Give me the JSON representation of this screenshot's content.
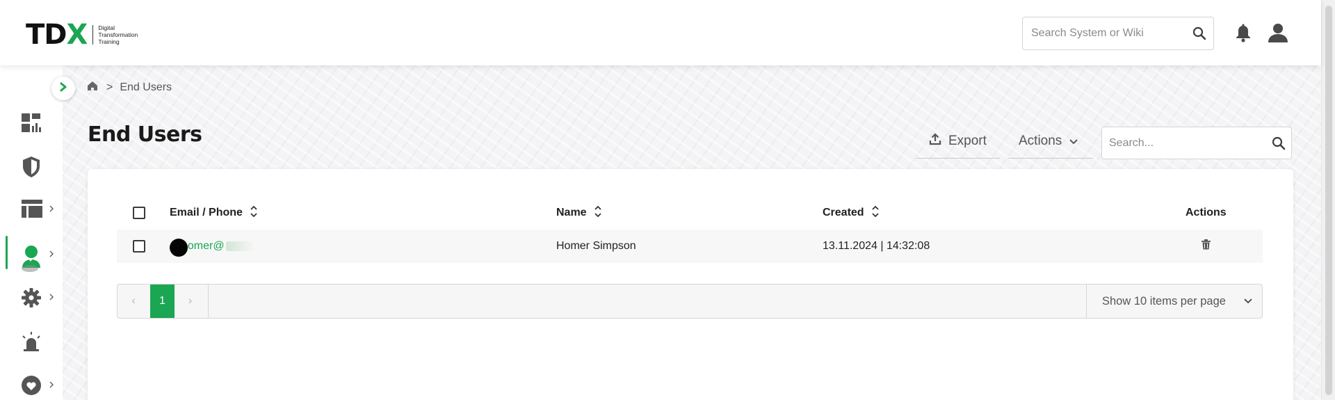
{
  "brand": {
    "logo_letters": [
      "T",
      "D",
      "X"
    ],
    "subtitle_lines": [
      "Digital",
      "Transformation",
      "Training"
    ],
    "accent_color": "#1aa652"
  },
  "header": {
    "search_placeholder": "Search System or Wiki",
    "icons": [
      "search-icon",
      "bell-icon",
      "user-icon"
    ]
  },
  "sidebar": {
    "items": [
      {
        "icon": "dashboard-icon",
        "has_submenu": false,
        "active": false
      },
      {
        "icon": "shield-icon",
        "has_submenu": false,
        "active": false
      },
      {
        "icon": "layout-icon",
        "has_submenu": true,
        "active": false
      },
      {
        "icon": "users-icon",
        "has_submenu": true,
        "active": true
      },
      {
        "icon": "gear-icon",
        "has_submenu": true,
        "active": false
      },
      {
        "icon": "alarm-icon",
        "has_submenu": false,
        "active": false
      },
      {
        "icon": "heart-icon",
        "has_submenu": true,
        "active": false
      }
    ]
  },
  "breadcrumb": {
    "separator": ">",
    "current": "End Users"
  },
  "page": {
    "title": "End Users",
    "export_label": "Export",
    "actions_label": "Actions",
    "search_placeholder": "Search..."
  },
  "table": {
    "columns": [
      {
        "key": "email",
        "label": "Email / Phone",
        "sortable": true
      },
      {
        "key": "name",
        "label": "Name",
        "sortable": true
      },
      {
        "key": "created",
        "label": "Created",
        "sortable": true
      },
      {
        "key": "actions",
        "label": "Actions",
        "sortable": false
      }
    ],
    "rows": [
      {
        "email": "homer@",
        "name": "Homer Simpson",
        "created": "13.11.2024 | 14:32:08"
      }
    ]
  },
  "pagination": {
    "prev": "‹",
    "current_page": "1",
    "next": "›",
    "per_page_label": "Show 10 items per page"
  }
}
